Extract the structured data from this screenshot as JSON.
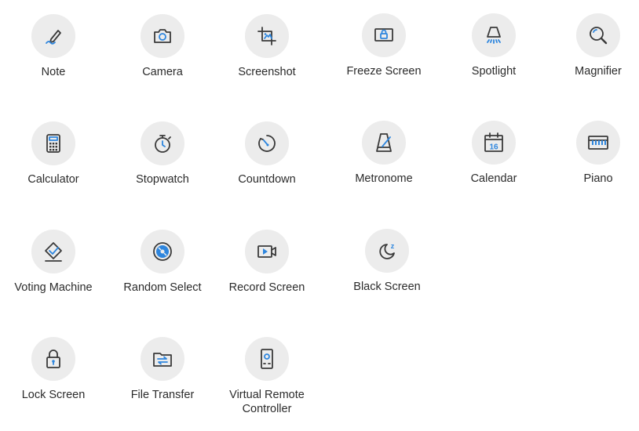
{
  "tools": [
    {
      "label": "Note",
      "icon": "pen-icon"
    },
    {
      "label": "Camera",
      "icon": "camera-icon"
    },
    {
      "label": "Screenshot",
      "icon": "crop-icon"
    },
    {
      "label": "Freeze Screen",
      "icon": "freeze-lock-icon"
    },
    {
      "label": "Spotlight",
      "icon": "spotlight-icon"
    },
    {
      "label": "Magnifier",
      "icon": "magnifier-icon"
    },
    {
      "label": "Calculator",
      "icon": "calculator-icon"
    },
    {
      "label": "Stopwatch",
      "icon": "stopwatch-icon"
    },
    {
      "label": "Countdown",
      "icon": "countdown-icon"
    },
    {
      "label": "Metronome",
      "icon": "metronome-icon"
    },
    {
      "label": "Calendar",
      "icon": "calendar-icon",
      "icon_text": "16"
    },
    {
      "label": "Piano",
      "icon": "piano-icon"
    },
    {
      "label": "Voting Machine",
      "icon": "voting-icon"
    },
    {
      "label": "Random Select",
      "icon": "random-select-icon"
    },
    {
      "label": "Record Screen",
      "icon": "record-screen-icon"
    },
    {
      "label": "Black Screen",
      "icon": "moon-icon",
      "icon_text": "z"
    },
    {
      "label": "Lock Screen",
      "icon": "lock-icon"
    },
    {
      "label": "File Transfer",
      "icon": "file-transfer-icon"
    },
    {
      "label": "Virtual Remote\nController",
      "icon": "remote-controller-icon"
    }
  ],
  "colors": {
    "accent": "#2e86de",
    "icon": "#3a3a3a",
    "circle": "#ececec",
    "text": "#2b2b2b"
  }
}
